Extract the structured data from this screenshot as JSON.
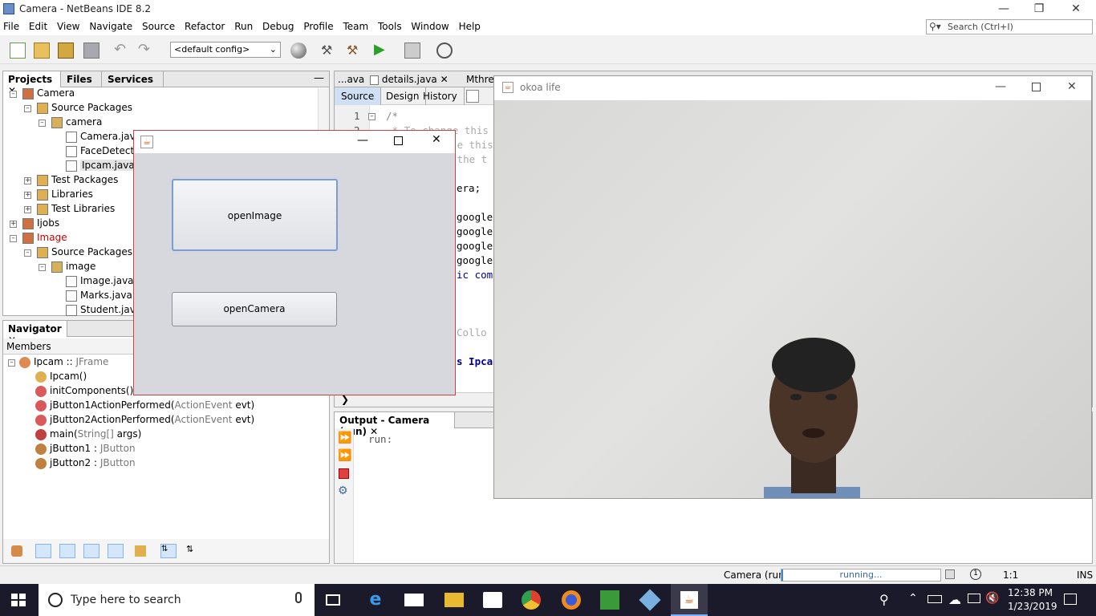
{
  "app": {
    "window_title": "Camera - NetBeans IDE 8.2",
    "menu": [
      "File",
      "Edit",
      "View",
      "Navigate",
      "Source",
      "Refactor",
      "Run",
      "Debug",
      "Profile",
      "Team",
      "Tools",
      "Window",
      "Help"
    ],
    "search_placeholder": "Search (Ctrl+I)",
    "config": "<default config>"
  },
  "projects": {
    "tabs": [
      "Projects",
      "Files",
      "Services"
    ],
    "tree": [
      {
        "label": "Camera",
        "indent": 0
      },
      {
        "label": "Source Packages",
        "indent": 1
      },
      {
        "label": "camera",
        "indent": 2
      },
      {
        "label": "Camera.java",
        "indent": 3
      },
      {
        "label": "FaceDetecto",
        "indent": 3
      },
      {
        "label": "Ipcam.java",
        "indent": 3
      },
      {
        "label": "Test Packages",
        "indent": 1
      },
      {
        "label": "Libraries",
        "indent": 1
      },
      {
        "label": "Test Libraries",
        "indent": 1
      },
      {
        "label": "Ijobs",
        "indent": 0
      },
      {
        "label": "Image",
        "indent": 0
      },
      {
        "label": "Source Packages",
        "indent": 1
      },
      {
        "label": "image",
        "indent": 2
      },
      {
        "label": "Image.java",
        "indent": 3
      },
      {
        "label": "Marks.java",
        "indent": 3
      },
      {
        "label": "Student.java",
        "indent": 3
      }
    ]
  },
  "navigator": {
    "title": "Navigator",
    "members_label": "Members",
    "items": [
      {
        "name": "Ipcam :: ",
        "type": "JFrame"
      },
      {
        "name": "Ipcam()",
        "type": ""
      },
      {
        "name": "initComponents()",
        "type": ""
      },
      {
        "name": "jButton1ActionPerformed(",
        "type": "ActionEvent",
        "suffix": " evt)"
      },
      {
        "name": "jButton2ActionPerformed(",
        "type": "ActionEvent",
        "suffix": " evt)"
      },
      {
        "name": "main(",
        "type": "String[]",
        "suffix": " args)"
      },
      {
        "name": "jButton1 : ",
        "type": "JButton"
      },
      {
        "name": "jButton2 : ",
        "type": "JButton"
      }
    ]
  },
  "editor": {
    "tabs": [
      "...ava",
      "details.java",
      "Mthrea"
    ],
    "subtabs": [
      "Source",
      "Design",
      "History"
    ],
    "line_numbers": [
      "1",
      "2"
    ],
    "code_fragments": [
      "/*",
      " * To change this",
      "   e this",
      "   the t",
      "era;",
      "google",
      "google",
      "google",
      "google",
      "ic com",
      "Collo",
      "s Ipca"
    ]
  },
  "output": {
    "title": "Output - Camera (run)",
    "text": "run:"
  },
  "dialog": {
    "btn_open_image": "openImage",
    "btn_open_camera": "openCamera"
  },
  "camera_window": {
    "title": "okoa life"
  },
  "status": {
    "task": "Camera (run)",
    "progress_text": "running...",
    "position": "1:1",
    "mode": "INS"
  },
  "taskbar": {
    "search_placeholder": "Type here to search",
    "time": "12:38 PM",
    "date": "1/23/2019"
  }
}
